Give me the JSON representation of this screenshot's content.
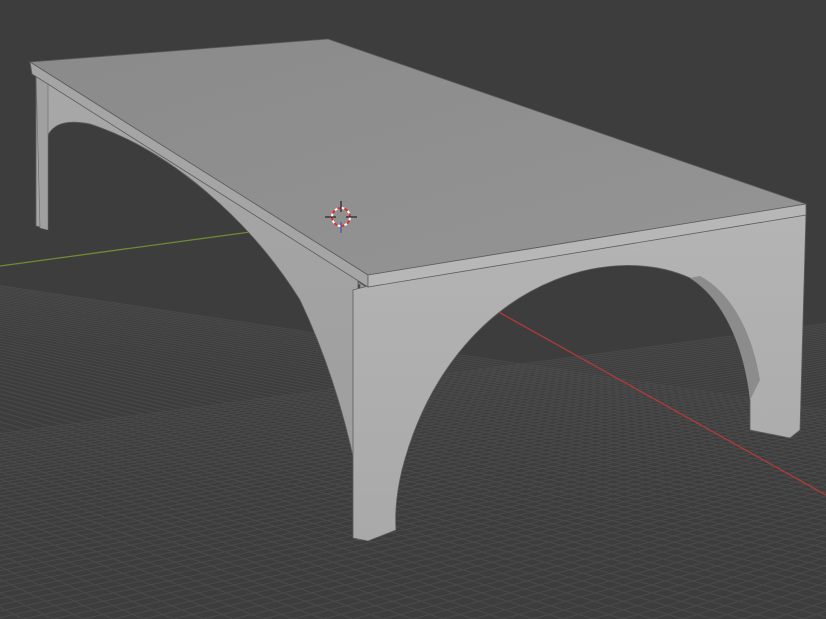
{
  "viewport": {
    "background_color": "#3d3d3d",
    "grid_color": "#4a4a4a",
    "x_axis_color": "#b03a3a",
    "y_axis_color": "#6f8a34",
    "object": {
      "type": "table-mesh",
      "top_color": "#8e8e8e",
      "front_face_color": "#b0b0b0",
      "side_face_color": "#a6a6a6",
      "back_face_color": "#9e9e9e",
      "edge_color": "#5c5c5c"
    },
    "cursor": {
      "icon": "3d-cursor-icon",
      "ring_colors": [
        "#e03030",
        "#ffffff"
      ]
    }
  }
}
